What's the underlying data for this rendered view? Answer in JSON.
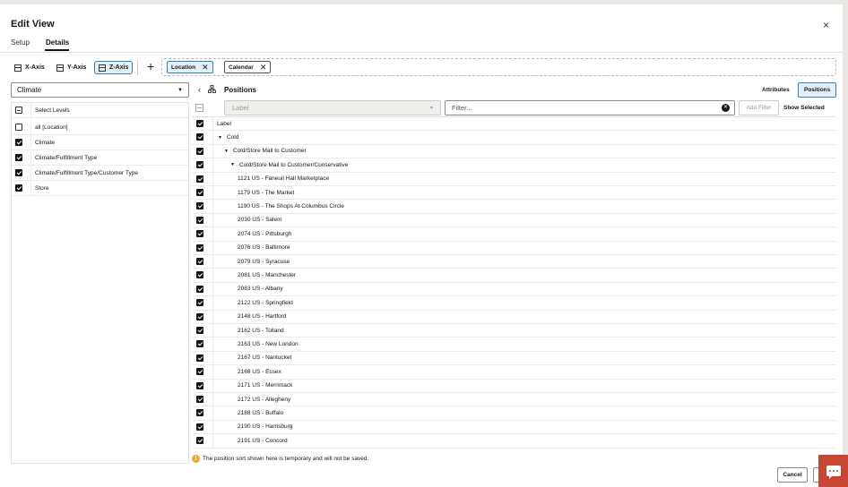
{
  "dialog": {
    "title": "Edit View",
    "close_glyph": "×"
  },
  "tabs": [
    {
      "label": "Setup"
    },
    {
      "label": "Details",
      "active": true
    }
  ],
  "axes": {
    "x_label": "X-Axis",
    "y_label": "Y-Axis",
    "z_label": "Z-Axis",
    "selected": "Z-Axis",
    "add_glyph": "+",
    "chips": [
      {
        "label": "Location",
        "selected": true
      },
      {
        "label": "Calendar",
        "selected": false
      }
    ]
  },
  "dimension_select": {
    "value": "Climate"
  },
  "levels": {
    "header": "Select Levels",
    "items": [
      {
        "label": "all [Location]",
        "checked": false
      },
      {
        "label": "Climate",
        "checked": true
      },
      {
        "label": "Climate/Fulfillment Type",
        "checked": true
      },
      {
        "label": "Climate/Fulfillment Type/Customer Type",
        "checked": true
      },
      {
        "label": "Store",
        "checked": true
      }
    ]
  },
  "positions": {
    "title": "Positions",
    "attributes_label": "Attributes",
    "positions_label": "Positions",
    "label_select_placeholder": "Label",
    "filter_placeholder": "Filter...",
    "add_filter_label": "Add Filter",
    "show_selected_label": "Show Selected",
    "column_header": "Label",
    "rows": [
      {
        "label": "Cold",
        "level": 0,
        "expanded": true
      },
      {
        "label": "Cold/Store Mail to Customer",
        "level": 1,
        "expanded": true
      },
      {
        "label": "Cold/Store Mail to Customer/Conservative",
        "level": 2,
        "expanded": true
      },
      {
        "label": "1121 US - Faneuil Hall Marketplace",
        "level": 3
      },
      {
        "label": "1179 US - The Market",
        "level": 3
      },
      {
        "label": "1190 US - The Shops At Columbus Circle",
        "level": 3
      },
      {
        "label": "2030 US - Salem",
        "level": 3
      },
      {
        "label": "2074 US - Pittsburgh",
        "level": 3
      },
      {
        "label": "2076 US - Baltimore",
        "level": 3
      },
      {
        "label": "2079 US - Syracuse",
        "level": 3
      },
      {
        "label": "2081 US - Manchester",
        "level": 3
      },
      {
        "label": "2083 US - Albany",
        "level": 3
      },
      {
        "label": "2122 US - Springfield",
        "level": 3
      },
      {
        "label": "2148 US - Hartford",
        "level": 3
      },
      {
        "label": "2162 US - Tolland",
        "level": 3
      },
      {
        "label": "2163 US - New London",
        "level": 3
      },
      {
        "label": "2167 US - Nantucket",
        "level": 3
      },
      {
        "label": "2168 US - Essex",
        "level": 3
      },
      {
        "label": "2171 US - Merrimack",
        "level": 3
      },
      {
        "label": "2172 US - Allegheny",
        "level": 3
      },
      {
        "label": "2188 US - Buffalo",
        "level": 3
      },
      {
        "label": "2190 US - Harrisburg",
        "level": 3
      },
      {
        "label": "2191 US - Concord",
        "level": 3
      }
    ]
  },
  "info_message": "The position sort shown here is temporary and will not be saved.",
  "footer": {
    "cancel_label": "Cancel"
  },
  "colors": {
    "accent": "#3a7fb0",
    "selected_bg": "#e4f0f8",
    "chat": "#c74634",
    "warning": "#f0a82d"
  }
}
